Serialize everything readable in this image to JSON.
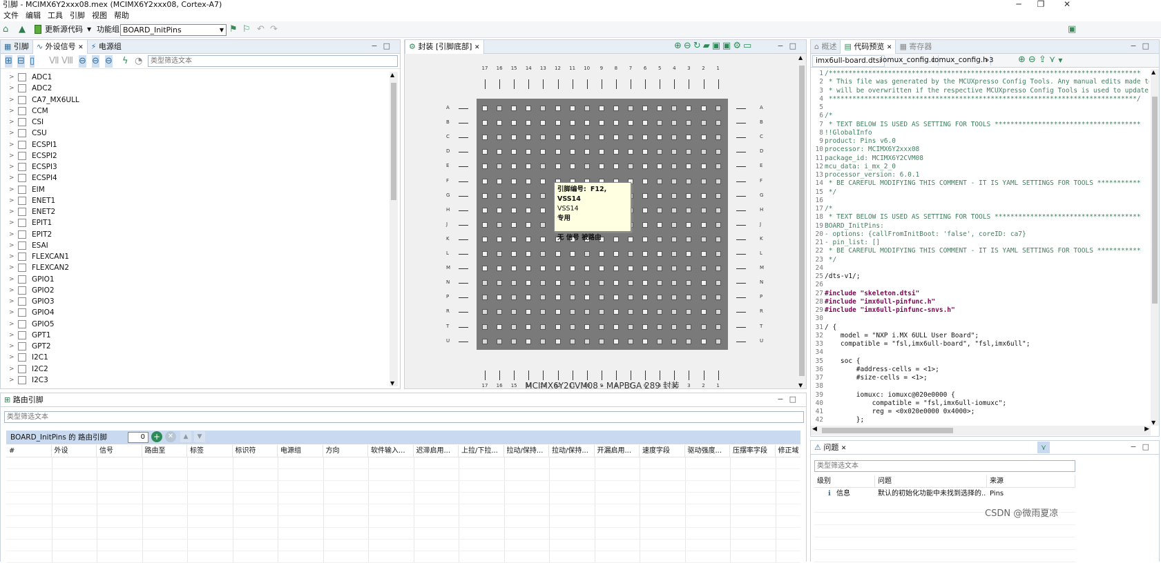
{
  "window": {
    "title": "引脚 - MCIMX6Y2xxx08.mex (MCIMX6Y2xxx08, Cortex-A7)",
    "minimize": "─",
    "restore": "❐",
    "close": "✕"
  },
  "menu": [
    "文件",
    "编辑",
    "工具",
    "引脚",
    "视图",
    "帮助"
  ],
  "toolbar": {
    "update_code": "更新源代码",
    "function_group_label": "功能组",
    "function_group_value": "BOARD_InitPins"
  },
  "left_panel": {
    "tabs": [
      {
        "label": "引脚"
      },
      {
        "label": "外设信号"
      },
      {
        "label": "电源组"
      }
    ],
    "filter_placeholder": "类型筛选文本",
    "peripherals": [
      "ADC1",
      "ADC2",
      "CA7_MX6ULL",
      "CCM",
      "CSI",
      "CSU",
      "ECSPI1",
      "ECSPI2",
      "ECSPI3",
      "ECSPI4",
      "EIM",
      "ENET1",
      "ENET2",
      "EPIT1",
      "EPIT2",
      "ESAI",
      "FLEXCAN1",
      "FLEXCAN2",
      "GPIO1",
      "GPIO2",
      "GPIO3",
      "GPIO4",
      "GPIO5",
      "GPT1",
      "GPT2",
      "I2C1",
      "I2C2",
      "I2C3"
    ]
  },
  "center_panel": {
    "tab_label": "封装 [引脚底部]",
    "columns": [
      "17",
      "16",
      "15",
      "14",
      "13",
      "12",
      "11",
      "10",
      "9",
      "8",
      "7",
      "6",
      "5",
      "4",
      "3",
      "2",
      "1"
    ],
    "rows": [
      "A",
      "B",
      "C",
      "D",
      "E",
      "F",
      "G",
      "H",
      "J",
      "K",
      "L",
      "M",
      "N",
      "P",
      "R",
      "T",
      "U"
    ],
    "caption": "MCIMX6Y2CVM08 - MAPBGA 289 封装",
    "tooltip": {
      "title_label": "引脚编号:",
      "title_value": "F12, VSS14",
      "name": "VSS14",
      "type": "专用",
      "status": "无 信号 被路由"
    }
  },
  "right_panel": {
    "tabs": [
      {
        "label": "概述"
      },
      {
        "label": "代码预览"
      },
      {
        "label": "寄存器"
      }
    ],
    "file_tabs": [
      "imx6ull-board.dtsi",
      "iomux_config.c",
      "iomux_config.h",
      "»3"
    ],
    "code": [
      "/*******************************************************************************",
      " * This file was generated by the MCUXpresso Config Tools. Any manual edits made to this file",
      " * will be overwritten if the respective MCUXpresso Config Tools is used to update this file.",
      " ******************************************************************************/",
      "",
      "/*",
      " * TEXT BELOW IS USED AS SETTING FOR TOOLS *************************************",
      "!!GlobalInfo",
      "product: Pins v6.0",
      "processor: MCIMX6Y2xxx08",
      "package_id: MCIMX6Y2CVM08",
      "mcu_data: i_mx_2_0",
      "processor_version: 6.0.1",
      " * BE CAREFUL MODIFYING THIS COMMENT - IT IS YAML SETTINGS FOR TOOLS ***********",
      " */",
      "",
      "/*",
      " * TEXT BELOW IS USED AS SETTING FOR TOOLS *************************************",
      "BOARD_InitPins:",
      "- options: {callFromInitBoot: 'false', coreID: ca7}",
      "- pin_list: []",
      " * BE CAREFUL MODIFYING THIS COMMENT - IT IS YAML SETTINGS FOR TOOLS ***********",
      " */",
      "",
      "/dts-v1/;",
      "",
      "#include \"skeleton.dtsi\"",
      "#include \"imx6ull-pinfunc.h\"",
      "#include \"imx6ull-pinfunc-snvs.h\"",
      "",
      "/ {",
      "    model = \"NXP i.MX 6ULL User Board\";",
      "    compatible = \"fsl,imx6ull-board\", \"fsl,imx6ull\";",
      "",
      "    soc {",
      "        #address-cells = <1>;",
      "        #size-cells = <1>;",
      "",
      "        iomuxc: iomuxc@020e0000 {",
      "            compatible = \"fsl,imx6ull-iomuxc\";",
      "            reg = <0x020e0000 0x4000>;",
      "        };"
    ]
  },
  "routing_panel": {
    "tab_label": "路由引脚",
    "filter_placeholder": "类型筛选文本",
    "table_title": "BOARD_InitPins 的 路由引脚",
    "count": "0",
    "columns": [
      "#",
      "外设",
      "信号",
      "路由至",
      "标签",
      "标识符",
      "电源组",
      "方向",
      "软件输入...",
      "迟滞启用...",
      "上拉/下拉...",
      "拉动/保持...",
      "拉动/保持...",
      "开漏启用...",
      "速度字段",
      "驱动强度...",
      "压摆率字段",
      "修正域"
    ]
  },
  "problems_panel": {
    "tab_label": "问题",
    "filter_placeholder": "类型筛选文本",
    "columns": [
      "级别",
      "问题",
      "来源"
    ],
    "rows": [
      {
        "level": "信息",
        "problem": "默认的初始化功能中未找到选择的...",
        "source": "Pins"
      }
    ]
  },
  "watermark": "CSDN @微雨夏凉",
  "colors": {
    "chip": "#7a7a7a",
    "tab_bg": "#e8eef5",
    "table_header": "#c9daf0",
    "tooltip": "#ffffe1",
    "accent": "#2e8b57"
  }
}
